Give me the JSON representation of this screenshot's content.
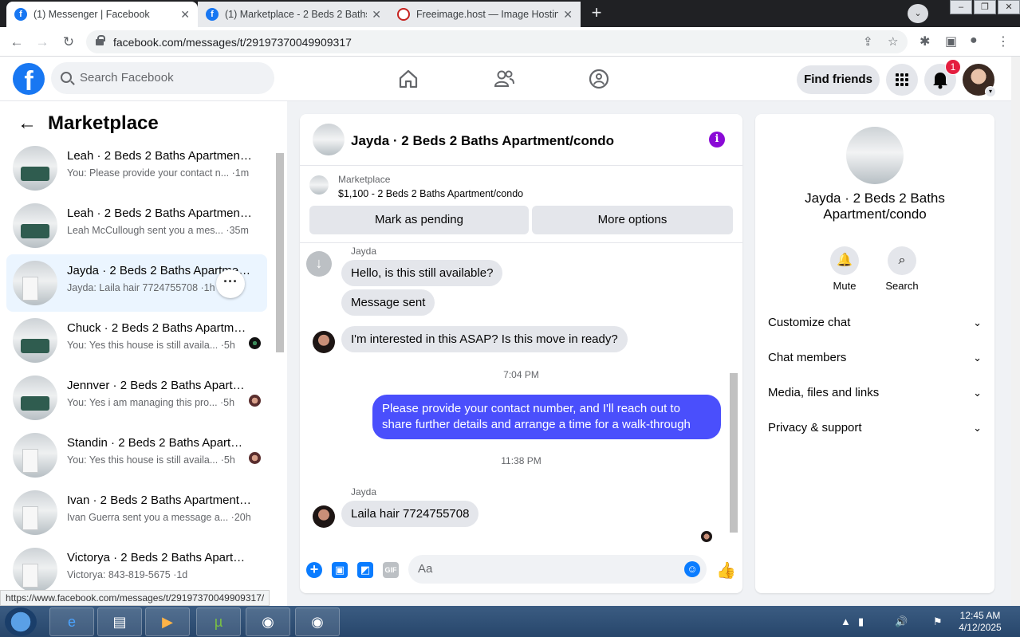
{
  "browser": {
    "tabs": [
      {
        "title": "(1) Messenger | Facebook",
        "icon": "facebook-icon"
      },
      {
        "title": "(1) Marketplace - 2 Beds 2 Baths",
        "icon": "facebook-icon"
      },
      {
        "title": "Freeimage.host — Image Hosting",
        "icon": "freeimage-icon"
      }
    ],
    "url": "facebook.com/messages/t/29197370049909317"
  },
  "header": {
    "search_placeholder": "Search Facebook",
    "find_friends": "Find friends",
    "notification_count": "1"
  },
  "sidebar": {
    "title": "Marketplace",
    "conversations": [
      {
        "name": "Leah · 2 Beds 2 Baths Apartment/condo",
        "preview": "You: Please provide your contact n... ·1m",
        "thumb": "bed"
      },
      {
        "name": "Leah · 2 Beds 2 Baths Apartment/condo",
        "preview": "Leah McCullough sent you a mes... ·35m",
        "thumb": "bed"
      },
      {
        "name": "Jayda · 2 Beds 2 Baths Apartment/condo",
        "preview": "Jayda: Laila hair 7724755708 ·1h",
        "thumb": "bath"
      },
      {
        "name": "Chuck · 2 Beds 2 Baths Apartment/condo",
        "preview": "You: Yes this house is still availa... ·5h",
        "thumb": "bed"
      },
      {
        "name": "Jennver · 2 Beds 2 Baths Apartment/condo",
        "preview": "You: Yes i am managing this pro... ·5h",
        "thumb": "bed"
      },
      {
        "name": "Standin · 2 Beds 2 Baths Apartment/condo",
        "preview": "You: Yes this house is still availa... ·5h",
        "thumb": "bath"
      },
      {
        "name": "Ivan · 2 Beds 2 Baths Apartment/condo",
        "preview": "Ivan Guerra sent you a message a... ·20h",
        "thumb": "bath"
      },
      {
        "name": "Victorya · 2 Beds 2 Baths Apartment/condo",
        "preview": "Victorya: 843-819-5675 ·1d",
        "thumb": "bath"
      }
    ]
  },
  "status_url": "https://www.facebook.com/messages/t/29197370049909317/",
  "chat": {
    "title": "Jayda · 2 Beds 2 Baths Apartment/condo",
    "listing_label": "Marketplace",
    "listing_price": "$1,100 - 2 Beds 2 Baths Apartment/condo",
    "mark_pending": "Mark as pending",
    "more_options": "More options",
    "messages": {
      "sender1": "Jayda",
      "m1": "Hello, is this still available?",
      "m2": "Message sent",
      "m3": "I'm interested in this ASAP? Is this move in ready?",
      "time1": "7:04 PM",
      "m4": "Please provide your contact number, and I'll reach out to share further details and arrange a time for a walk-through",
      "time2": "11:38 PM",
      "sender2": "Jayda",
      "m5": "Laila hair 7724755708"
    },
    "composer_placeholder": "Aa"
  },
  "info_panel": {
    "name": "Jayda · 2 Beds 2 Baths Apartment/condo",
    "mute": "Mute",
    "search": "Search",
    "sections": [
      "Customize chat",
      "Chat members",
      "Media, files and links",
      "Privacy & support"
    ]
  },
  "taskbar": {
    "time": "12:45 AM",
    "date": "4/12/2025"
  }
}
